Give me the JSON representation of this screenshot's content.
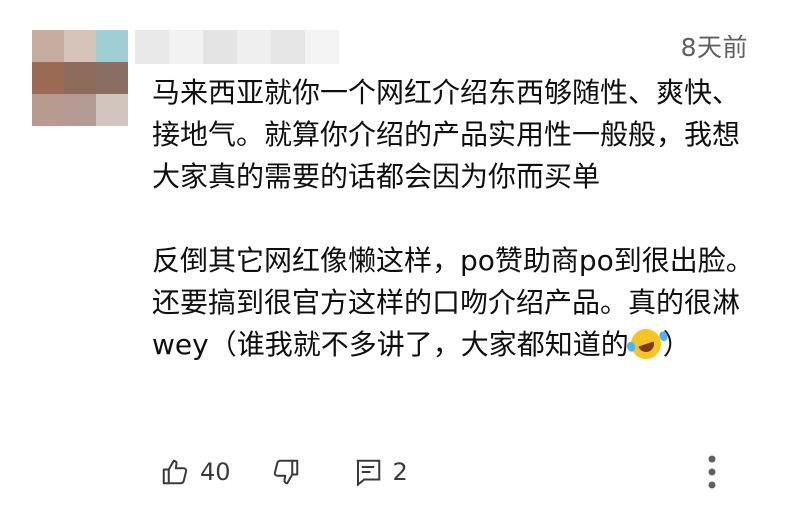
{
  "comment": {
    "timestamp": "8天前",
    "paragraphs": [
      "马来西亚就你一个网红介绍东西够随性、爽快、接地气。就算你介绍的产品实用性一般般，我想大家真的需要的话都会因为你而买单",
      "反倒其它网红像懒这样，po赞助商po到很出脸。还要搞到很官方这样的口吻介绍产品。真的很淋wey（谁我就不多讲了，大家都知道的"
    ],
    "closing": "）",
    "emoji": "rolling-on-floor-laughing-emoji"
  },
  "actions": {
    "like_count": "40",
    "reply_count": "2"
  },
  "icons": {
    "like": "thumbs-up-icon",
    "dislike": "thumbs-down-icon",
    "reply": "reply-icon",
    "more": "more-vertical-icon"
  },
  "colors": {
    "text": "#0f0f0f",
    "secondary": "#606060"
  }
}
